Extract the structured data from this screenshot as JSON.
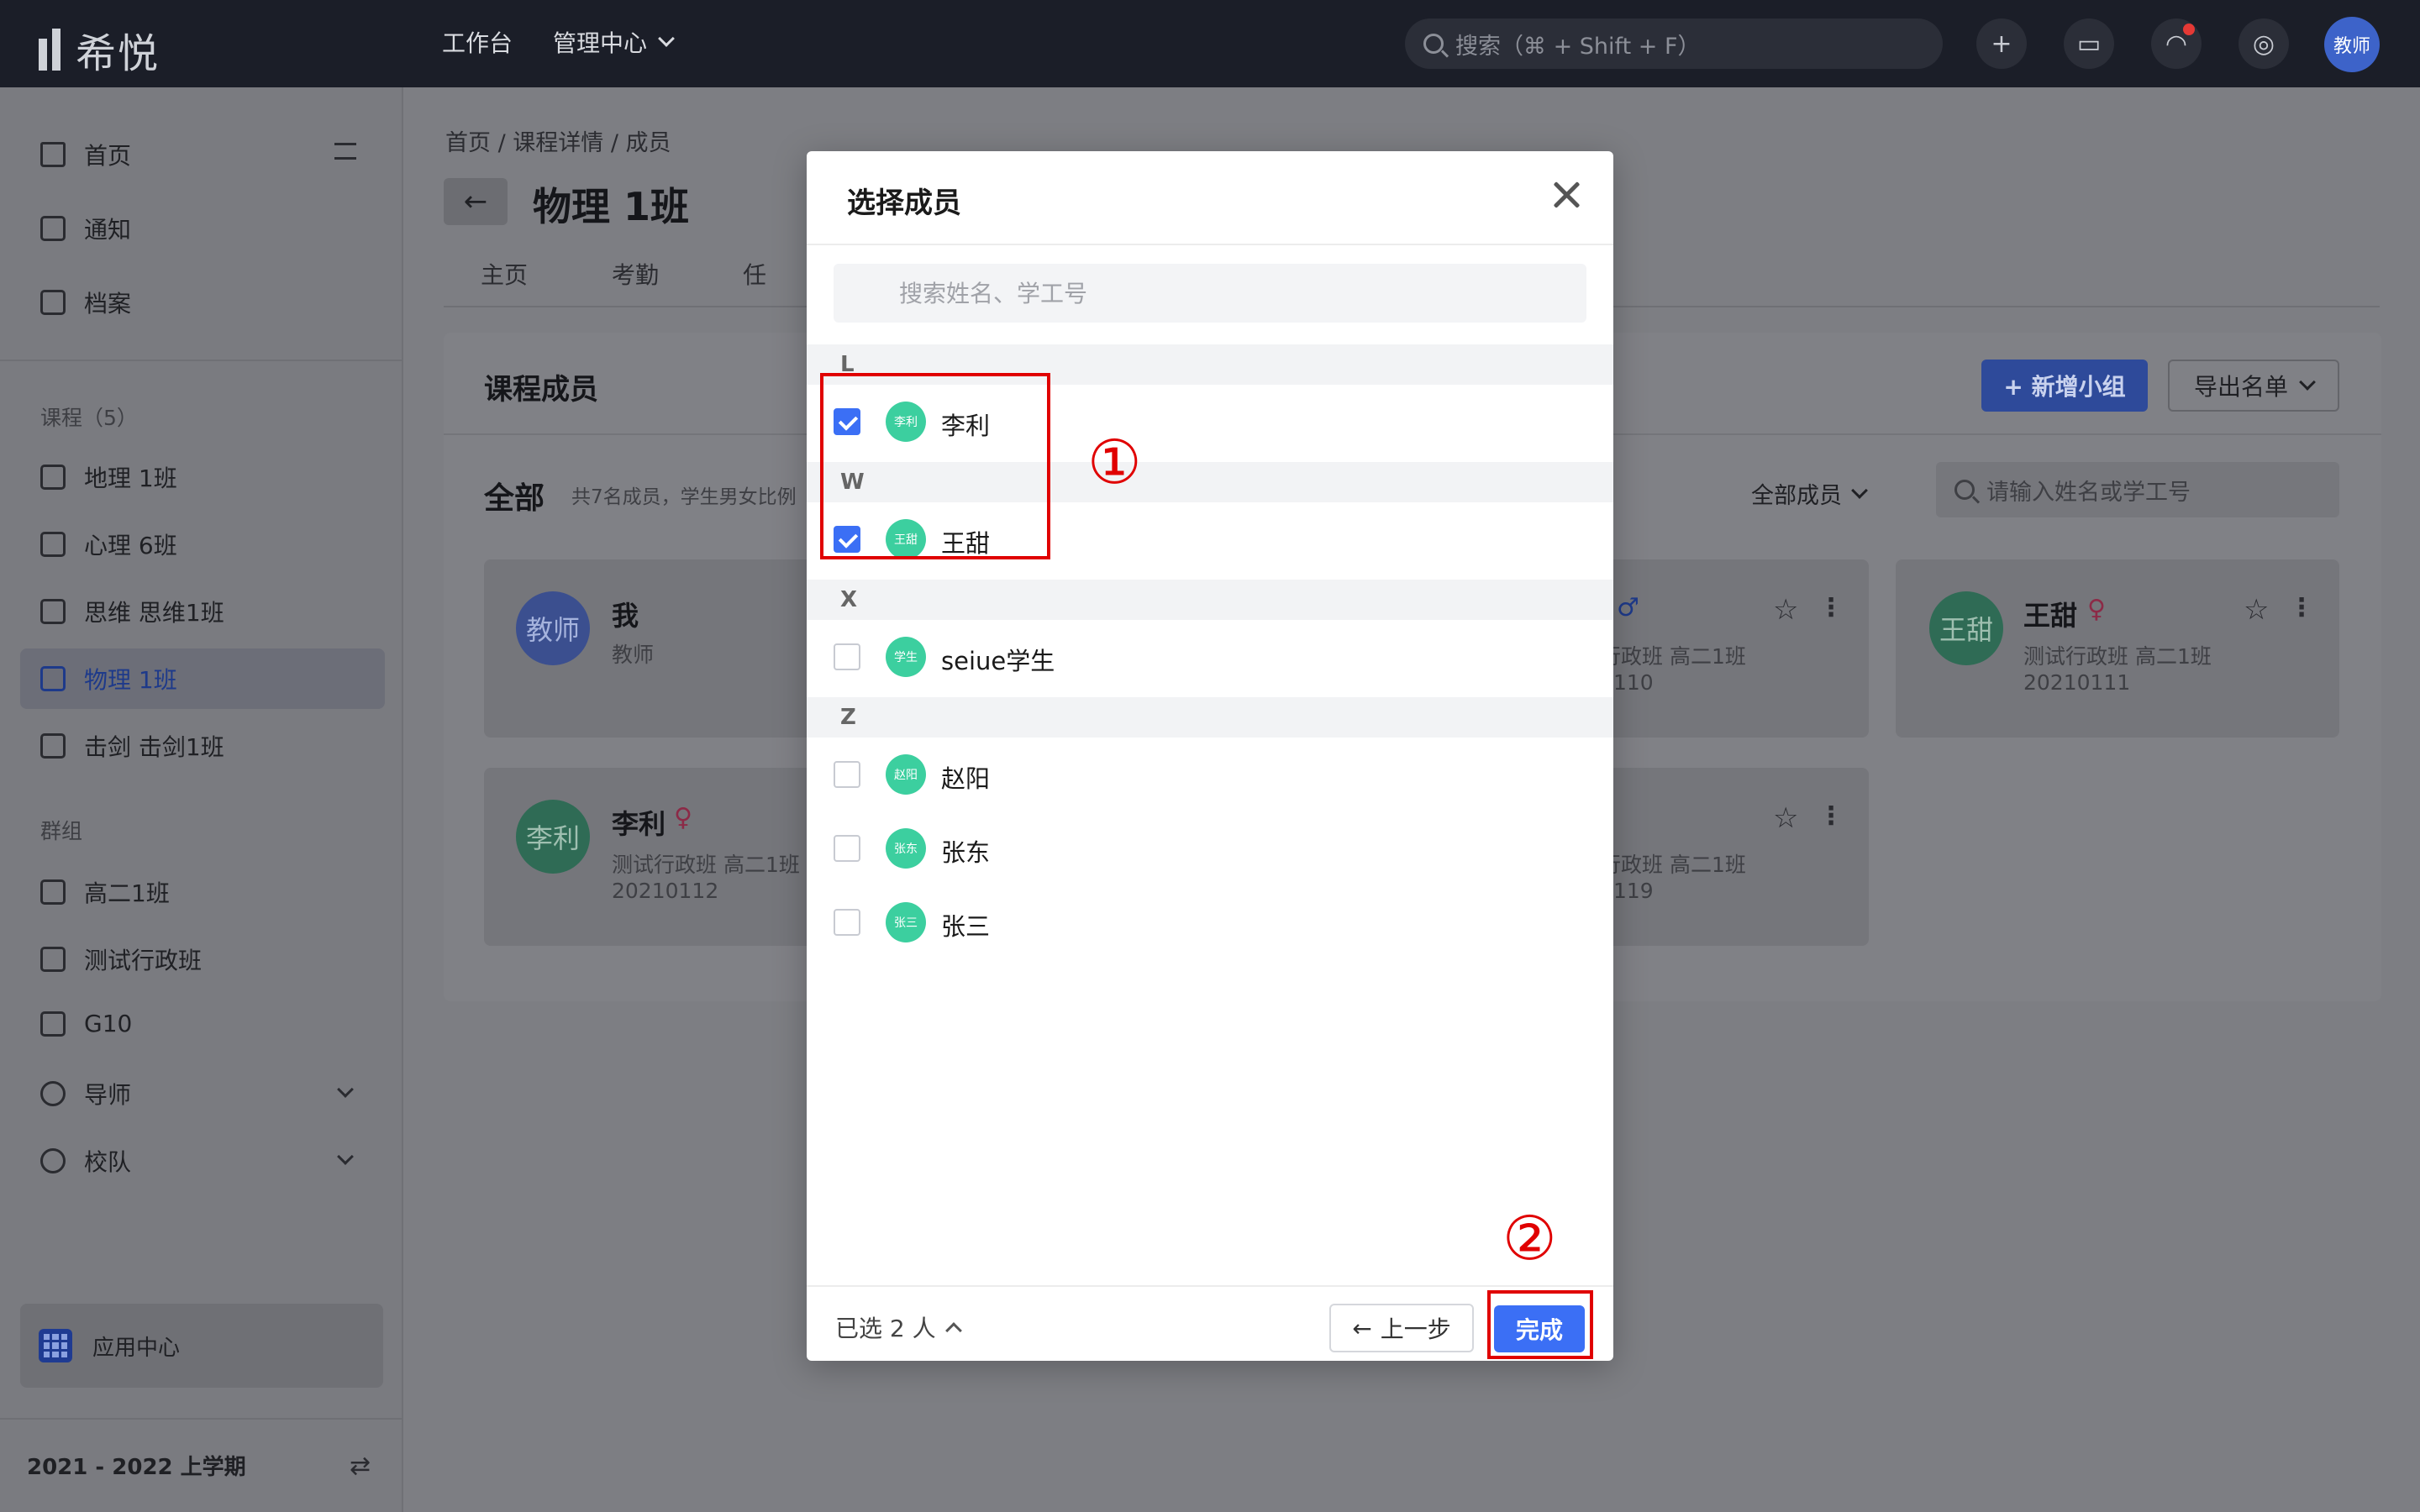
{
  "app": {
    "logo_text": "希悦",
    "nav": [
      {
        "label": "工作台"
      },
      {
        "label": "管理中心"
      }
    ],
    "search_placeholder": "搜索（⌘ + Shift + F）",
    "avatar_label": "教师"
  },
  "sidebar": {
    "top_items": [
      {
        "label": "首页",
        "icon": "home-icon"
      },
      {
        "label": "通知",
        "icon": "message-icon"
      },
      {
        "label": "档案",
        "icon": "archive-icon"
      }
    ],
    "course_section": "课程（5）",
    "courses": [
      {
        "label": "地理 1班"
      },
      {
        "label": "心理 6班"
      },
      {
        "label": "思维 思维1班"
      },
      {
        "label": "物理 1班",
        "active": true
      },
      {
        "label": "击剑 击剑1班"
      }
    ],
    "group_section": "群组",
    "groups": [
      {
        "label": "高二1班"
      },
      {
        "label": "测试行政班"
      },
      {
        "label": "G10"
      },
      {
        "label": "导师"
      },
      {
        "label": "校队"
      }
    ],
    "app_center": "应用中心",
    "term": "2021 - 2022 上学期"
  },
  "main": {
    "breadcrumb": "首页  /  课程详情  /  成员",
    "title": "物理 1班",
    "tabs": [
      "主页",
      "考勤",
      "任"
    ],
    "members_title": "课程成员",
    "add_group_btn": "+ 新增小组",
    "export_btn": "导出名单",
    "all_label": "全部",
    "all_sub": "共7名成员，学生男女比例",
    "filter_label": "全部成员",
    "search_placeholder": "请输入姓名或学工号",
    "cards": [
      {
        "avatar": "教师",
        "name": "我",
        "role": "教师"
      },
      {
        "line1": "行政班 高二1班",
        "line2": "110"
      },
      {
        "avatar": "王甜",
        "name": "王甜",
        "line1": "测试行政班 高二1班",
        "line2": "20210111"
      },
      {
        "avatar": "李利",
        "name": "李利",
        "line1": "测试行政班 高二1班",
        "line2": "20210112"
      },
      {
        "line1": "行政班 高二1班",
        "line2": "119"
      }
    ]
  },
  "modal": {
    "title": "选择成员",
    "search_placeholder": "搜索姓名、学工号",
    "groups": [
      {
        "letter": "L",
        "members": [
          {
            "avatar": "李利",
            "name": "李利",
            "checked": true
          }
        ]
      },
      {
        "letter": "W",
        "members": [
          {
            "avatar": "王甜",
            "name": "王甜",
            "checked": true
          }
        ]
      },
      {
        "letter": "X",
        "members": [
          {
            "avatar": "学生",
            "name": "seiue学生",
            "checked": false
          }
        ]
      },
      {
        "letter": "Z",
        "members": [
          {
            "avatar": "赵阳",
            "name": "赵阳",
            "checked": false
          },
          {
            "avatar": "张东",
            "name": "张东",
            "checked": false
          },
          {
            "avatar": "张三",
            "name": "张三",
            "checked": false
          }
        ]
      }
    ],
    "selected_count": "已选 2 人",
    "prev_btn": "上一步",
    "done_btn": "完成"
  },
  "annotations": {
    "step1": "①",
    "step2": "②",
    "color": "#e00000"
  }
}
